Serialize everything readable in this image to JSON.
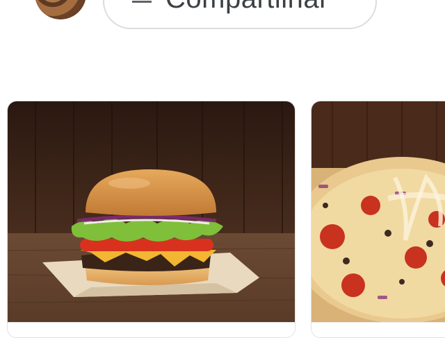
{
  "header": {
    "share_label": "Compartilhar"
  },
  "cards": [
    {
      "kind": "burger"
    },
    {
      "kind": "pizza"
    }
  ],
  "colors": {
    "wood_dark": "#3a2418",
    "bun": "#d99a4e",
    "lettuce": "#7fbf3a",
    "tomato": "#d8321e",
    "cheese": "#f2b632"
  }
}
